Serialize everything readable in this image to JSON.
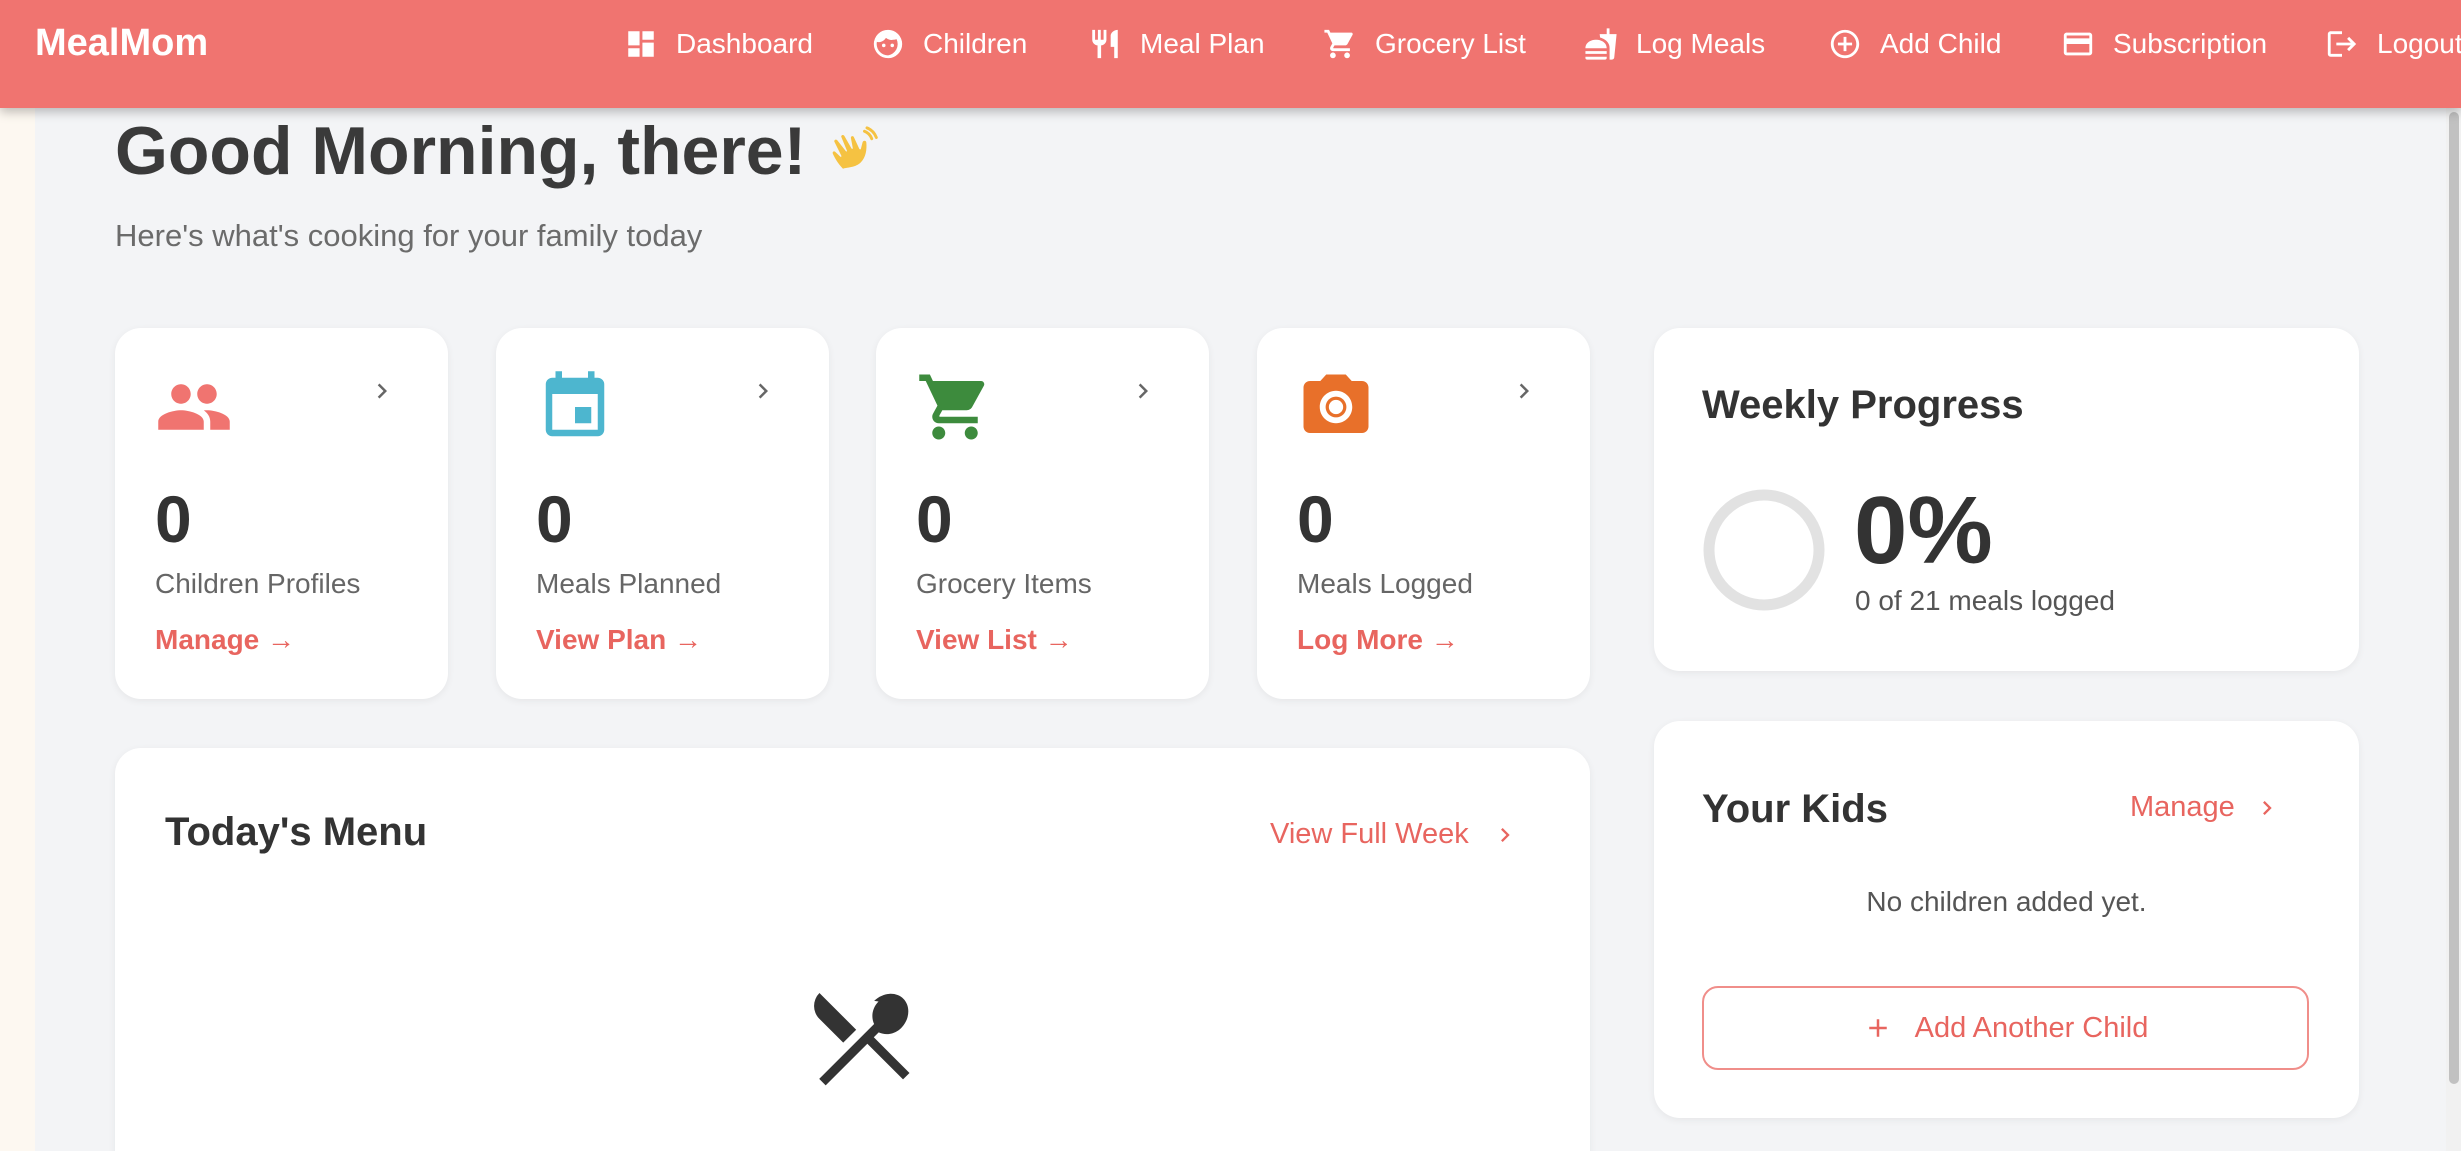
{
  "app": {
    "brand": "MealMom"
  },
  "nav": {
    "items": [
      {
        "label": "Dashboard",
        "icon": "dashboard-icon"
      },
      {
        "label": "Children",
        "icon": "child-face-icon"
      },
      {
        "label": "Meal Plan",
        "icon": "restaurant-icon"
      },
      {
        "label": "Grocery List",
        "icon": "cart-icon"
      },
      {
        "label": "Log Meals",
        "icon": "fastfood-icon"
      },
      {
        "label": "Add Child",
        "icon": "add-circle-icon"
      },
      {
        "label": "Subscription",
        "icon": "credit-card-icon"
      },
      {
        "label": "Logout",
        "icon": "logout-icon"
      }
    ]
  },
  "greeting": {
    "title": "Good Morning, there!",
    "emoji": "👋",
    "subtitle": "Here's what's cooking for your family today"
  },
  "stats": [
    {
      "value": "0",
      "label": "Children Profiles",
      "link": "Manage →",
      "icon": "people-icon",
      "color": "#f07470"
    },
    {
      "value": "0",
      "label": "Meals Planned",
      "link": "View Plan →",
      "icon": "calendar-icon",
      "color": "#4db6cf"
    },
    {
      "value": "0",
      "label": "Grocery Items",
      "link": "View List →",
      "icon": "cart-icon",
      "color": "#3d8b3d"
    },
    {
      "value": "0",
      "label": "Meals Logged",
      "link": "Log More →",
      "icon": "camera-icon",
      "color": "#e8702a"
    }
  ],
  "progress": {
    "title": "Weekly Progress",
    "percent_text": "0%",
    "percent": 0,
    "subtitle": "0 of 21 meals logged"
  },
  "kids": {
    "title": "Your Kids",
    "manage": "Manage",
    "empty": "No children added yet.",
    "add_button": "Add Another Child"
  },
  "menu": {
    "title": "Today's Menu",
    "link": "View Full Week"
  },
  "colors": {
    "brand": "#f07470",
    "accent": "#e8655f",
    "background": "#f3f4f6"
  }
}
